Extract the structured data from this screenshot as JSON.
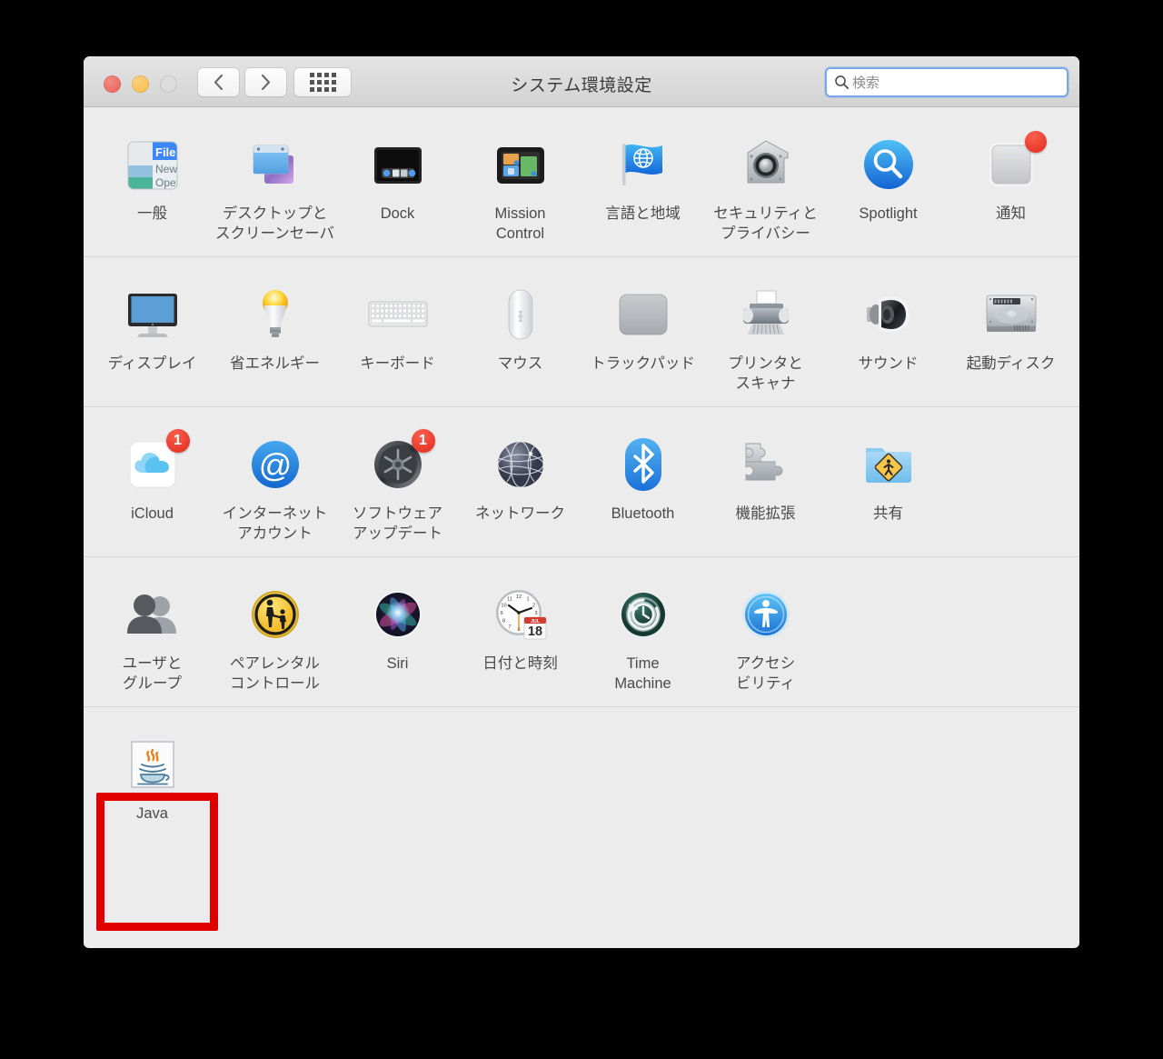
{
  "window": {
    "title": "システム環境設定",
    "traffic_lights": [
      "close",
      "minimize",
      "zoom"
    ],
    "nav": {
      "back_label": "戻る",
      "forward_label": "進む",
      "grid_label": "すべてを表示"
    }
  },
  "search": {
    "placeholder": "検索",
    "value": "",
    "icon": "search-icon"
  },
  "colors": {
    "highlight": "#e00000",
    "badge": "#e3281c",
    "window_bg": "#ececec",
    "titlebar_bg": "#d8d8d8",
    "search_focus_ring": "#7aa7e8",
    "label_text": "#4a4a4a"
  },
  "highlight": {
    "target": "Java",
    "visible": true
  },
  "sections": [
    {
      "name": "personal",
      "items": [
        {
          "id": "general",
          "label": "一般",
          "icon": "general-icon"
        },
        {
          "id": "desktop",
          "label": "デスクトップと\nスクリーンセーバ",
          "icon": "desktop-screensaver-icon"
        },
        {
          "id": "dock",
          "label": "Dock",
          "icon": "dock-icon"
        },
        {
          "id": "mission-control",
          "label": "Mission\nControl",
          "icon": "mission-control-icon"
        },
        {
          "id": "language-region",
          "label": "言語と地域",
          "icon": "language-region-icon"
        },
        {
          "id": "security-privacy",
          "label": "セキュリティと\nプライバシー",
          "icon": "security-privacy-icon"
        },
        {
          "id": "spotlight",
          "label": "Spotlight",
          "icon": "spotlight-icon"
        },
        {
          "id": "notifications",
          "label": "通知",
          "icon": "notifications-icon",
          "badge": ""
        }
      ]
    },
    {
      "name": "hardware",
      "items": [
        {
          "id": "displays",
          "label": "ディスプレイ",
          "icon": "display-icon"
        },
        {
          "id": "energy-saver",
          "label": "省エネルギー",
          "icon": "energy-saver-icon"
        },
        {
          "id": "keyboard",
          "label": "キーボード",
          "icon": "keyboard-icon"
        },
        {
          "id": "mouse",
          "label": "マウス",
          "icon": "mouse-icon"
        },
        {
          "id": "trackpad",
          "label": "トラックパッド",
          "icon": "trackpad-icon"
        },
        {
          "id": "printers",
          "label": "プリンタと\nスキャナ",
          "icon": "printer-scanner-icon"
        },
        {
          "id": "sound",
          "label": "サウンド",
          "icon": "sound-icon"
        },
        {
          "id": "startup-disk",
          "label": "起動ディスク",
          "icon": "startup-disk-icon"
        }
      ]
    },
    {
      "name": "internet-wireless",
      "items": [
        {
          "id": "icloud",
          "label": "iCloud",
          "icon": "icloud-icon",
          "badge": "1"
        },
        {
          "id": "internet-accounts",
          "label": "インターネット\nアカウント",
          "icon": "internet-accounts-icon"
        },
        {
          "id": "software-update",
          "label": "ソフトウェア\nアップデート",
          "icon": "software-update-icon",
          "badge": "1"
        },
        {
          "id": "network",
          "label": "ネットワーク",
          "icon": "network-icon"
        },
        {
          "id": "bluetooth",
          "label": "Bluetooth",
          "icon": "bluetooth-icon"
        },
        {
          "id": "extensions",
          "label": "機能拡張",
          "icon": "extensions-icon"
        },
        {
          "id": "sharing",
          "label": "共有",
          "icon": "sharing-icon"
        }
      ]
    },
    {
      "name": "system",
      "items": [
        {
          "id": "users-groups",
          "label": "ユーザと\nグループ",
          "icon": "users-groups-icon"
        },
        {
          "id": "parental",
          "label": "ペアレンタル\nコントロール",
          "icon": "parental-controls-icon"
        },
        {
          "id": "siri",
          "label": "Siri",
          "icon": "siri-icon"
        },
        {
          "id": "date-time",
          "label": "日付と時刻",
          "icon": "date-time-icon",
          "calendar": {
            "month": "JUL",
            "day": "18"
          }
        },
        {
          "id": "time-machine",
          "label": "Time\nMachine",
          "icon": "time-machine-icon"
        },
        {
          "id": "accessibility",
          "label": "アクセシ\nビリティ",
          "icon": "accessibility-icon"
        }
      ]
    },
    {
      "name": "other",
      "items": [
        {
          "id": "java",
          "label": "Java",
          "icon": "java-icon"
        }
      ]
    }
  ]
}
